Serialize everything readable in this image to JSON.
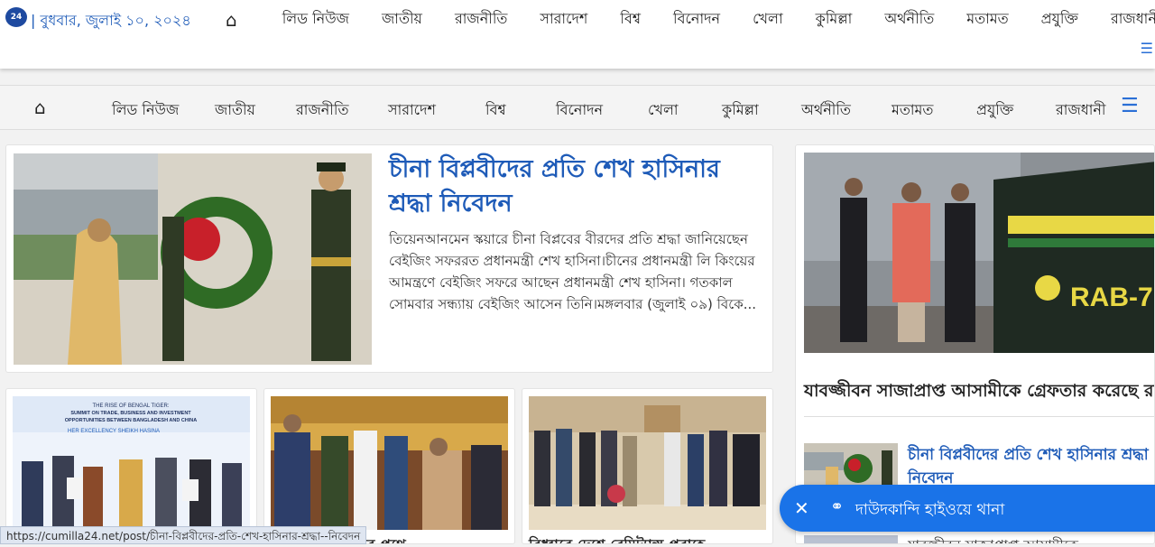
{
  "header": {
    "logo_text": "24",
    "date": "| বুধবার, জুলাই ১০, ২০২৪",
    "home_icon": "home-icon",
    "menu_icon": "hamburger-menu-icon"
  },
  "nav": {
    "items": [
      "লিড নিউজ",
      "জাতীয়",
      "রাজনীতি",
      "সারাদেশ",
      "বিশ্ব",
      "বিনোদন",
      "খেলা",
      "কুমিল্লা",
      "অর্থনীতি",
      "মতামত",
      "প্রযুক্তি",
      "রাজধানী"
    ]
  },
  "lead": {
    "title": "চীনা বিপ্লবীদের প্রতি শেখ হাসিনার শ্রদ্ধা নিবেদন",
    "summary": "তিয়েনআনমেন স্কয়ারে চীনা বিপ্লবের বীরদের প্রতি শ্রদ্ধা জানিয়েছেন বেইজিং সফররত প্রধানমন্ত্রী শেখ হাসিনা।চীনের প্রধানমন্ত্রী লি কিংয়ের আমন্ত্রণে বেইজিং সফরে আছেন প্রধানমন্ত্রী শেখ হাসিনা। গতকাল সোমবার সন্ধ্যায় বেইজিং আসেন তিনি।মঙ্গলবার (জুলাই ০৯) বিকে..."
  },
  "cards": [
    {
      "title": "",
      "banner_line1": "THE RISE OF BENGAL TIGER:",
      "banner_line2": "SUMMIT ON TRADE, BUSINESS AND INVESTMENT",
      "banner_line3": "OPPORTUNITIES BETWEEN BANGLADESH AND CHINA",
      "banner_line4": "HER EXCELLENCY SHEIKH HASINA"
    },
    {
      "title": "...স সফরে চীনের প্রথে..."
    },
    {
      "title": "বিধ্বারে দেশে রেমিট্যান্স প্রবাহে..."
    }
  ],
  "side": {
    "lead_title": "যাবজ্জীবন সাজাপ্রাপ্ত আসামীকে গ্রেফতার করেছে র‍্যাব",
    "vehicle_text": "RAB-7",
    "item_title": "চীনা বিপ্লবীদের প্রতি শেখ হাসিনার শ্রদ্ধা নিবেদন",
    "next_title": "যাবজ্জীবন সাজাপ্রাপ্ত আসামীকে..."
  },
  "toast": {
    "text": "দাউদকান্দি হাইওয়ে থানা",
    "close_icon": "close-icon",
    "tag_icon": "tag-icon"
  },
  "status_url": "https://cumilla24.net/post/চীনা-বিপ্লবীদের-প্রতি-শেখ-হাসিনার-শ্রদ্ধা--নিবেদন",
  "colors": {
    "accent": "#1e5bb8",
    "toast": "#1a73e8"
  }
}
